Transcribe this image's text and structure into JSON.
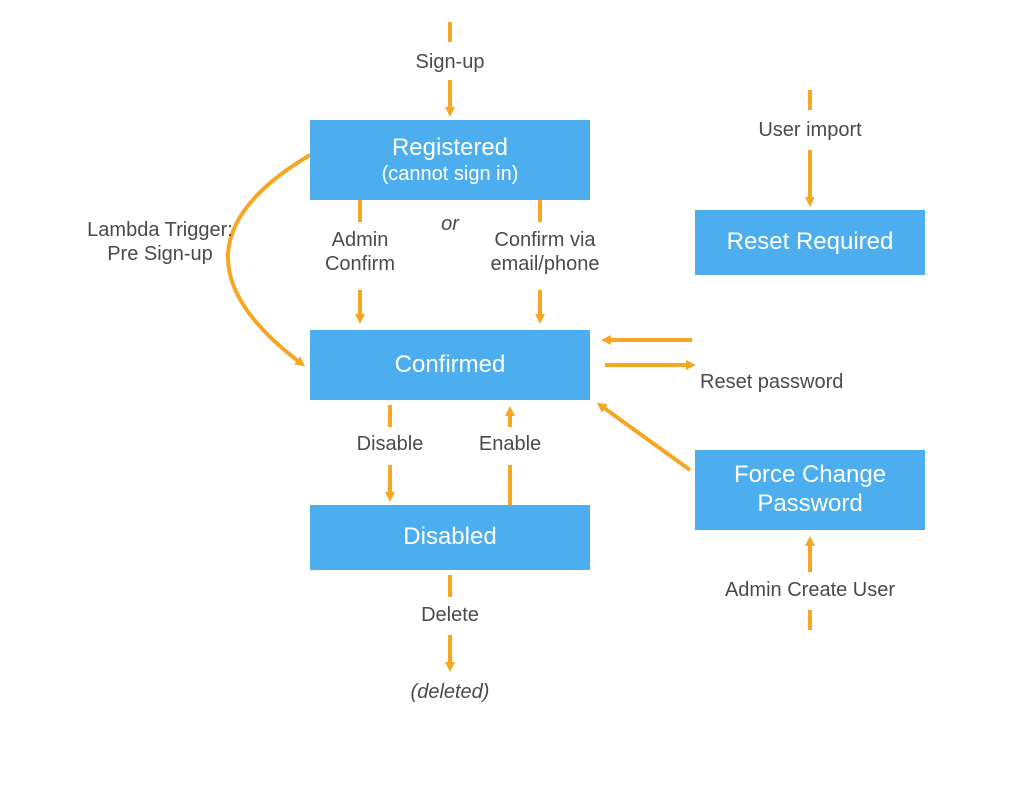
{
  "colors": {
    "state_box": "#4caeee",
    "state_text": "#ffffff",
    "arrow": "#f5a623",
    "label": "#4a4a4a"
  },
  "states": {
    "registered": {
      "title": "Registered",
      "subtitle": "(cannot sign in)"
    },
    "confirmed": {
      "title": "Confirmed"
    },
    "disabled": {
      "title": "Disabled"
    },
    "reset_required": {
      "title": "Reset Required"
    },
    "force_change_password": {
      "title": "Force Change",
      "subtitle": "Password"
    }
  },
  "labels": {
    "sign_up": "Sign-up",
    "user_import": "User import",
    "lambda_trigger_l1": "Lambda Trigger:",
    "lambda_trigger_l2": "Pre Sign-up",
    "admin_confirm_l1": "Admin",
    "admin_confirm_l2": "Confirm",
    "or": "or",
    "confirm_email_l1": "Confirm via",
    "confirm_email_l2": "email/phone",
    "reset_password": "Reset password",
    "disable": "Disable",
    "enable": "Enable",
    "delete": "Delete",
    "deleted": "(deleted)",
    "admin_create_user": "Admin Create User"
  }
}
